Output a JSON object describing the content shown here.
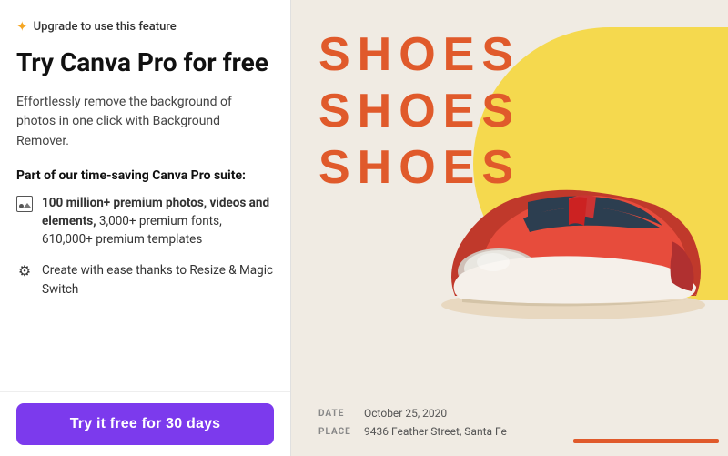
{
  "left_panel": {
    "upgrade_badge": "Upgrade to use this feature",
    "main_title": "Try Canva Pro for free",
    "description": "Effortlessly remove the background of photos in one click with Background Remover.",
    "suite_title": "Part of our time-saving Canva Pro suite:",
    "features": [
      {
        "id": "photos",
        "icon": "image-icon",
        "text_bold": "100 million+ premium photos, videos and elements,",
        "text_regular": " 3,000+ premium fonts, 610,000+ premium templates"
      },
      {
        "id": "resize",
        "icon": "resize-icon",
        "text_bold": "",
        "text_regular": "Create with ease thanks to Resize & Magic Switch"
      }
    ],
    "cta_button": "Try it free for 30 days"
  },
  "right_panel": {
    "title_lines": [
      "SHOES",
      "SHOES",
      "SHOES"
    ],
    "date_label": "DATE",
    "date_value": "October 25, 2020",
    "place_label": "PLACE",
    "place_value": "9436 Feather Street, Santa Fe"
  },
  "colors": {
    "accent_purple": "#7c3aed",
    "shoes_red": "#e05a2b",
    "yellow": "#f5d94e",
    "star": "#f5a623",
    "bg_cream": "#f0ebe3"
  }
}
